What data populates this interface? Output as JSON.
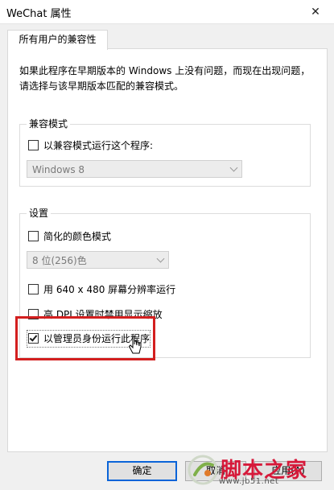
{
  "window": {
    "title": "WeChat 属性",
    "close_glyph": "✕"
  },
  "tabs": [
    {
      "label": "所有用户的兼容性"
    }
  ],
  "intro": {
    "line1": "如果此程序在早期版本的 Windows 上没有问题，而现在出现问题，",
    "line2": "请选择与该早期版本匹配的兼容模式。"
  },
  "compat_group": {
    "title": "兼容模式",
    "checkbox_label": "以兼容模式运行这个程序:",
    "checked": false,
    "select_value": "Windows 8"
  },
  "settings_group": {
    "title": "设置",
    "items": [
      {
        "label": "简化的颜色模式",
        "checked": false
      },
      {
        "label": "用 640 x 480 屏幕分辨率运行",
        "checked": false
      },
      {
        "label": "高 DPI 设置时禁用显示缩放",
        "checked": false
      },
      {
        "label": "以管理员身份运行此程序",
        "checked": true
      }
    ],
    "color_select_value": "8 位(256)色"
  },
  "buttons": {
    "ok": "确定",
    "cancel": "取消",
    "apply": "应用(A)"
  },
  "watermark": {
    "text": "脚本之家",
    "url": "www.jb51.net"
  },
  "colors": {
    "highlight": "#d31f1f",
    "watermark": "#d6193a",
    "ok_border": "#0a64d8"
  }
}
